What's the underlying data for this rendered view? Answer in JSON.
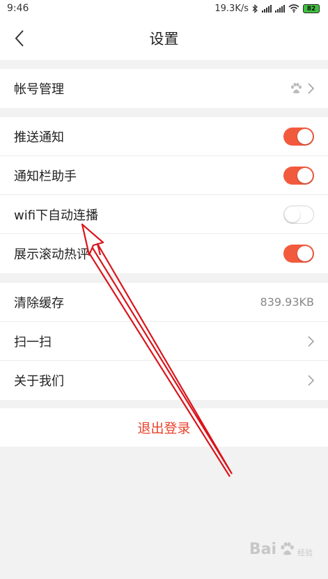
{
  "status_bar": {
    "time": "9:46",
    "speed": "19.3K/s",
    "battery": "82",
    "icons": [
      "bluetooth-icon",
      "signal-icon",
      "signal-icon",
      "wifi-icon",
      "battery-icon"
    ]
  },
  "header": {
    "title": "设置"
  },
  "sections": {
    "account": {
      "label": "帐号管理",
      "icon": "baidu-paw-icon"
    },
    "push": {
      "label": "推送通知",
      "toggle": "on"
    },
    "notif_helper": {
      "label": "通知栏助手",
      "toggle": "on"
    },
    "wifi_autoplay": {
      "label": "wifi下自动连播",
      "toggle": "off"
    },
    "hot_comments": {
      "label": "展示滚动热评",
      "toggle": "on"
    },
    "clear_cache": {
      "label": "清除缓存",
      "value": "839.93KB"
    },
    "scan": {
      "label": "扫一扫"
    },
    "about": {
      "label": "关于我们"
    }
  },
  "logout_label": "退出登录",
  "watermark": {
    "text": "Bai",
    "text2": "经验"
  },
  "colors": {
    "accent": "#f25a3d",
    "annotation": "#d9151c",
    "logout": "#e9412b"
  }
}
